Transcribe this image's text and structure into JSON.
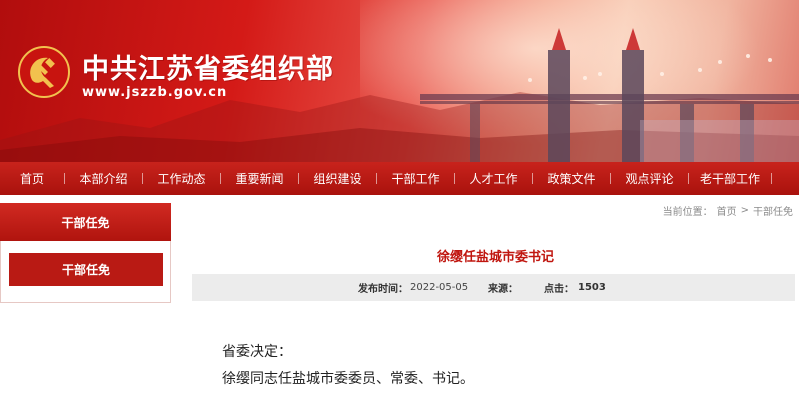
{
  "site": {
    "title": "中共江苏省委组织部",
    "url": "www.jszzb.gov.cn"
  },
  "nav": {
    "items": [
      "首页",
      "本部介绍",
      "工作动态",
      "重要新闻",
      "组织建设",
      "干部工作",
      "人才工作",
      "政策文件",
      "观点评论",
      "老干部工作"
    ]
  },
  "sidebar": {
    "header": "干部任免",
    "active_item": "干部任免"
  },
  "breadcrumb": {
    "prefix": "当前位置：",
    "home": "首页",
    "sep": ">",
    "current": "干部任免"
  },
  "article": {
    "title": "徐缨任盐城市委书记",
    "publish_label": "发布时间：",
    "publish_date": "2022-05-05",
    "source_label": "来源：",
    "source": "",
    "clicks_label": "点击：",
    "clicks": "1503",
    "paragraphs": [
      "省委决定：",
      "徐缨同志任盐城市委委员、常委、书记。"
    ]
  },
  "colors": {
    "brand_red": "#c0160f",
    "nav_red": "#b3160f",
    "meta_bg": "#ececec"
  },
  "icons": {
    "logo": "party-emblem-icon"
  }
}
